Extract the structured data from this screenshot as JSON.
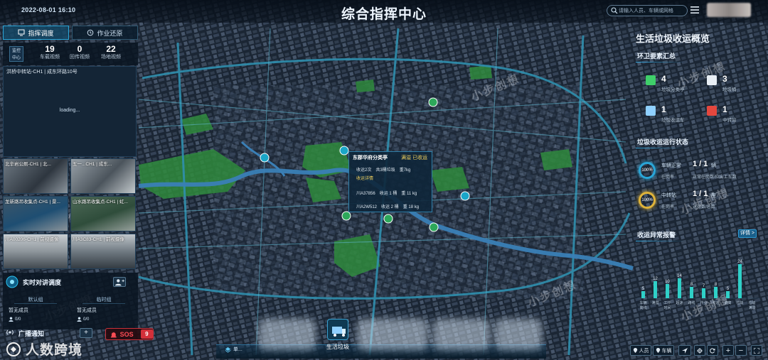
{
  "header": {
    "datetime": "2022-08-01 16:10",
    "title": "综合指挥中心",
    "search_placeholder": "请输入人员、车辆或网格"
  },
  "left_panel": {
    "tabs": [
      {
        "label": "指挥调度",
        "active": true
      },
      {
        "label": "作业还原",
        "active": false
      }
    ],
    "monitor_badge": [
      "监控",
      "中心"
    ],
    "stats": [
      {
        "value": "19",
        "label": "车载视频"
      },
      {
        "value": "0",
        "label": "回传视频"
      },
      {
        "value": "22",
        "label": "场地视频"
      }
    ],
    "main_video_caption": "洪桥中转站-CH1 | 成东环路10号",
    "main_video_status": "loading...",
    "thumbnails": [
      {
        "label": "北辛岩公厕-CH1 | 北..."
      },
      {
        "label": "五一...CH1 | 成东..."
      },
      {
        "label": "龙新路吊收集点-CH1 | 景..."
      },
      {
        "label": "山水路吊收集点-CH1 | 虹..."
      },
      {
        "label": "川A00206-CH1 | 前视摄像"
      },
      {
        "label": "川A3C83-CH1 | 前视摄像"
      }
    ],
    "intercom": {
      "title": "实时对讲调度",
      "groups": [
        {
          "name": "默认组",
          "status": "暂无成员",
          "count": "0/0"
        },
        {
          "name": "临时组",
          "status": "暂无成员",
          "count": "0/0"
        }
      ]
    },
    "broadcast": {
      "title": "广播通知",
      "plus": "+"
    },
    "sos": {
      "label": "SOS",
      "count": "9"
    }
  },
  "watermarks": {
    "brand": "小步创想",
    "corner": "人数跨境"
  },
  "dock": {
    "left_button": "单...",
    "active_item": "生活垃圾"
  },
  "popup": {
    "title": "东郡华府分类亭",
    "status": "满溢 已收运",
    "rows": [
      {
        "a": "收运2次",
        "b": "共3桶垃圾",
        "c": "重7kg"
      },
      {
        "a": "收运详情",
        "b": "",
        "c": ""
      },
      {
        "a": "川A37856",
        "b": "收运 1 桶",
        "c": "重 11 kg"
      },
      {
        "a": "川A2W512",
        "b": "收运 2 桶",
        "c": "重 18 kg"
      }
    ]
  },
  "right_panel": {
    "title": "生活垃圾收运概览",
    "elements_title": "环卫要素汇总",
    "elements": [
      {
        "value": "4",
        "label": "垃圾分类亭",
        "color": "#3fcf6a"
      },
      {
        "value": "3",
        "label": "垃圾桶",
        "color": "#e8eef4"
      },
      {
        "value": "1",
        "label": "垃圾收运车",
        "color": "#8fd0ff"
      },
      {
        "value": "1",
        "label": "中转站",
        "color": "#e4473e"
      }
    ],
    "run_title": "垃圾收运运行状态",
    "runs": [
      {
        "ring_text": "100%",
        "ring_color": "#2aa6d8",
        "label": "车辆正常",
        "value": "1 / 1",
        "unit": "辆",
        "sub": "在岗率",
        "desc": "正常在岗数/应出工车数"
      },
      {
        "ring_text": "100%",
        "ring_color": "#e0b43a",
        "label": "中转站",
        "value": "1 / 1",
        "unit": "座",
        "sub": "在岗率",
        "desc": "运行数/总数"
      }
    ],
    "alarm_title": "收运异常报警",
    "details_label": "详情 >",
    "chart_data": {
      "type": "bar",
      "categories": [
        "车辆离线",
        "满溢",
        "工作时间",
        "超速",
        "路线",
        "作业",
        "收运",
        "偏离",
        "垃圾",
        "垃圾满溢"
      ],
      "values": [
        5,
        12,
        10,
        14,
        8,
        7,
        8,
        5,
        24
      ],
      "ylim": [
        0,
        26
      ],
      "bar_color": "#2fd0c8"
    }
  },
  "controls": {
    "people": "人员",
    "vehicles": "车辆",
    "zoom_in": "+",
    "zoom_out": "−"
  }
}
